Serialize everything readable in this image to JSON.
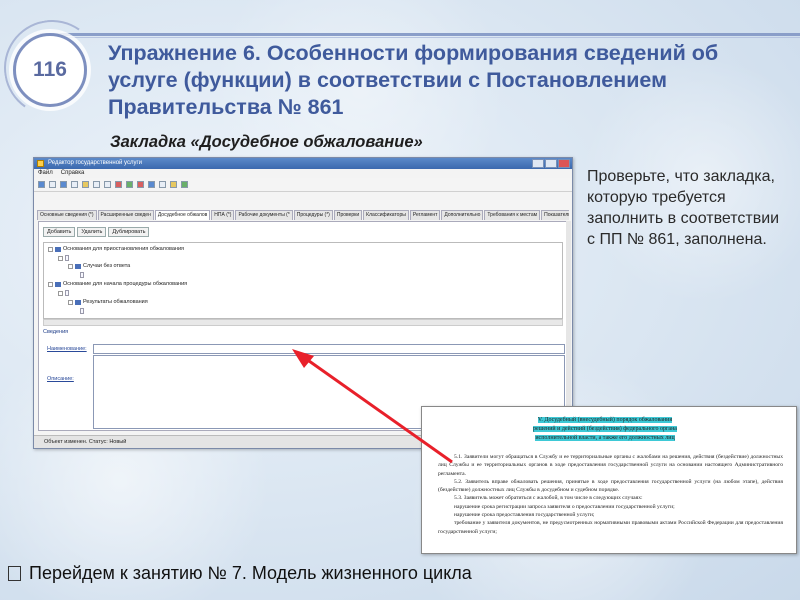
{
  "slide": {
    "number": "116",
    "title": "Упражнение 6. Особенности формирования сведений об услуге (функции) в соответствии с Постановлением Правительства № 861",
    "subtitle": "Закладка «Досудебное обжалование»",
    "instruction": "Проверьте, что закладка, которую требуется заполнить в соответствии с ПП № 861, заполнена.",
    "bottom_note": "Перейдем к занятию № 7. Модель жизненного цикла"
  },
  "app": {
    "window_title": "Редактор государственной услуги",
    "menu": [
      "Файл",
      "Справка"
    ],
    "tabs": [
      "Основные сведения (*)",
      "Расширенные сведен",
      "Досудебное обжалов",
      "НПА (*)",
      "Рабочие документы (*",
      "Процедуры (*)",
      "Проверки",
      "Классификаторы",
      "Регламент",
      "Дополнительно",
      "Требования к местам",
      "Показатели доступнос"
    ],
    "active_tab": 2,
    "actions": [
      "Добавить",
      "Удалить",
      "Дублировать"
    ],
    "tree": [
      "Основания для приостановления обжалования",
      "Случаи без ответа",
      "Основание для начала процедуры обжалования",
      "Результаты обжалования"
    ],
    "section": "Сведения",
    "name_label": "Наименование:",
    "desc_label": "Описание:",
    "status": "Объект изменен. Статус: Новый"
  },
  "excerpt": {
    "heading": [
      "V. Досудебный (внесудебный) порядок обжалования",
      "решений и действий (бездействия) федерального органа",
      "исполнительной власти, а также его должностных лиц"
    ],
    "paragraphs": [
      "5.1. Заявители могут обращаться в Службу и ее территориальные органы с жалобами на решения, действия (бездействие) должностных лиц Службы и ее территориальных органов в ходе предоставления государственной услуги на основании настоящего Административного регламента.",
      "5.2. Заявитель вправе обжаловать решения, принятые в ходе предоставления государственной услуги (на любом этапе), действия (бездействие) должностных лиц Службы в досудебном и судебном порядке.",
      "5.3. Заявитель может обратиться с жалобой, в том числе в следующих случаях:",
      "нарушение срока регистрации запроса заявителя о предоставлении государственной услуги;",
      "нарушение срока предоставления государственной услуги;",
      "требование у заявителя документов, не предусмотренных нормативными правовыми актами Российской Федерации для предоставления государственной услуги;"
    ]
  },
  "colors": {
    "title": "#3f5a9c",
    "arrow": "#e8202a",
    "highlight": "#3ec9d6",
    "window_titlebar": "#3b68ae"
  },
  "icons": [
    "doc-icon",
    "folder-icon",
    "expand-box-icon",
    "window-app-icon"
  ]
}
